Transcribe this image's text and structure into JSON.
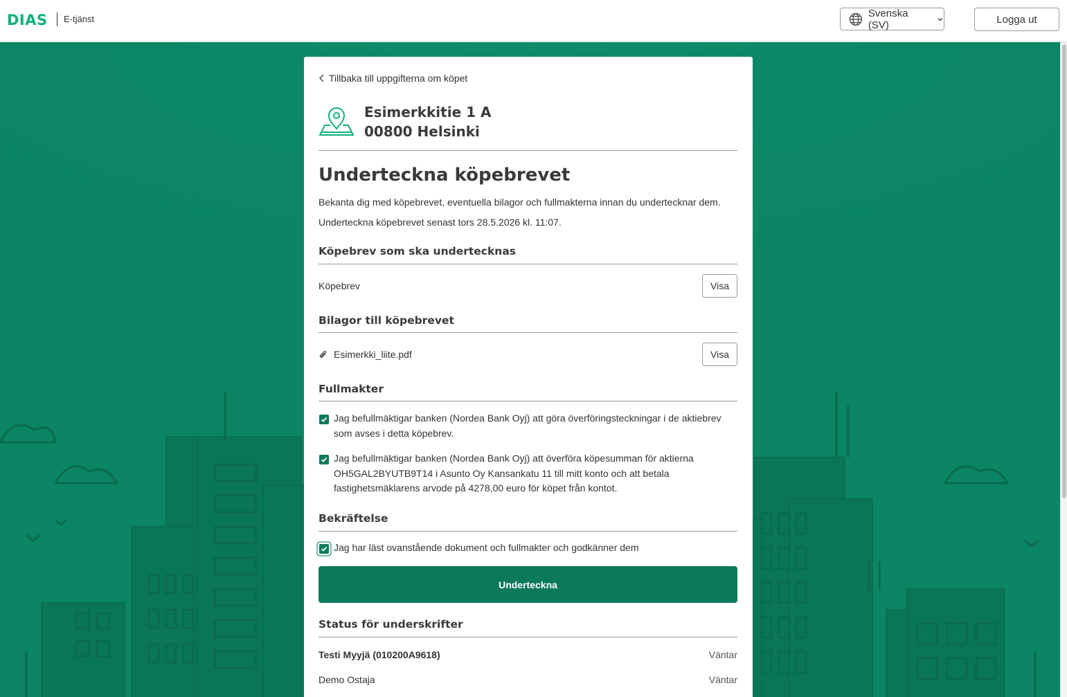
{
  "header": {
    "logo": "DIAS",
    "service": "E-tjänst",
    "language": "Svenska (SV)",
    "logout": "Logga ut"
  },
  "card": {
    "back": "Tillbaka till uppgifterna om köpet",
    "address_line1": "Esimerkkitie 1 A",
    "address_line2": "00800 Helsinki",
    "title": "Underteckna köpebrevet",
    "intro": "Bekanta dig med köpebrevet, eventuella bilagor och fullmakterna innan du undertecknar dem.",
    "deadline": "Underteckna köpebrevet senast tors 28.5.2026 kl. 11:07.",
    "deed_section": {
      "heading": "Köpebrev som ska undertecknas",
      "item": "Köpebrev",
      "view": "Visa"
    },
    "attachments_section": {
      "heading": "Bilagor till köpebrevet",
      "item": "Esimerkki_liite.pdf",
      "view": "Visa"
    },
    "powers_section": {
      "heading": "Fullmakter",
      "items": [
        {
          "text": "Jag befullmäktigar banken (Nordea Bank Oyj) att göra överföringsteckningar i de aktiebrev som avses i detta köpebrev.",
          "checked": true
        },
        {
          "text": "Jag befullmäktigar banken (Nordea Bank Oyj) att överföra köpesumman för aktierna OH5GAL2BYUTB9T14 i Asunto Oy Kansankatu 11 till mitt konto och att betala fastighetsmäklarens arvode på 4278,00 euro för köpet från kontot.",
          "checked": true
        }
      ]
    },
    "confirm_section": {
      "heading": "Bekräftelse",
      "text": "Jag har läst ovanstående dokument och fullmakter och godkänner dem",
      "checked": true
    },
    "sign_button": "Underteckna",
    "status_section": {
      "heading": "Status för underskrifter",
      "rows": [
        {
          "name": "Testi Myyjä (010200A9618)",
          "status": "Väntar"
        },
        {
          "name": "Demo Ostaja",
          "status": "Väntar"
        }
      ]
    }
  },
  "colors": {
    "brand": "#10b07a",
    "background": "#0b8563",
    "primary_button": "#0b7a5b"
  }
}
